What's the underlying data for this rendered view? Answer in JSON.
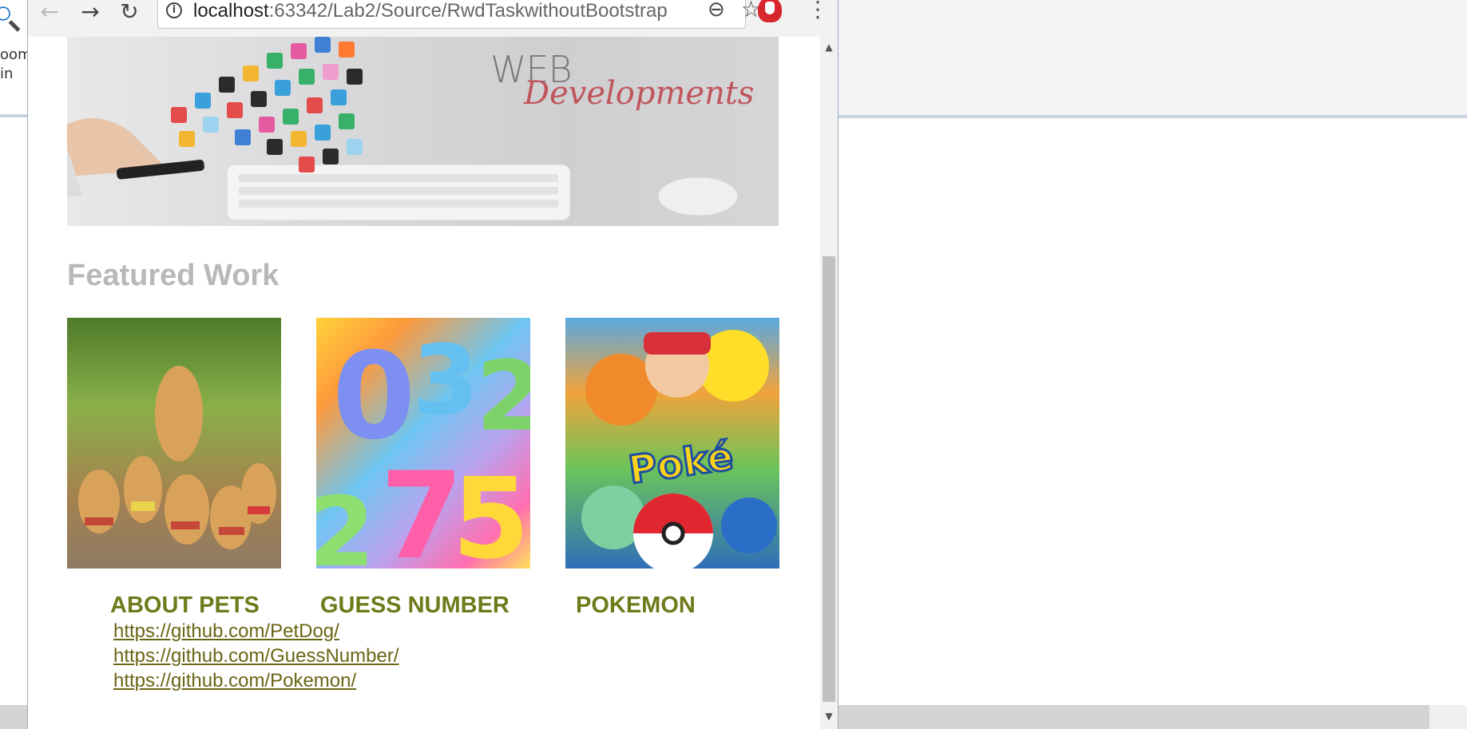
{
  "browser": {
    "url_host": "localhost",
    "url_path": ":63342/Lab2/Source/RwdTaskwithoutBootstrap"
  },
  "desktop": {
    "left_text_1": "oom",
    "left_text_2": "in"
  },
  "hero": {
    "line1": "WEB",
    "line2": "Developments"
  },
  "page": {
    "featured_title": "Featured Work",
    "projects": [
      {
        "title": "ABOUT PETS",
        "link": "https://github.com/PetDog/"
      },
      {
        "title": "GUESS NUMBER",
        "link": "https://github.com/GuessNumber/"
      },
      {
        "title": "POKEMON",
        "link": "https://github.com/Pokemon/"
      }
    ]
  },
  "icons": {
    "back": "arrow-left-icon",
    "forward": "arrow-right-icon",
    "reload": "reload-icon",
    "info": "info-icon",
    "zoom": "zoom-out-icon",
    "star": "star-icon",
    "extension": "adblock-icon",
    "menu": "kebab-menu-icon"
  },
  "colors": {
    "project_title": "#6f7a1a",
    "link": "#6a6514",
    "featured_title": "#b8b8b8"
  }
}
